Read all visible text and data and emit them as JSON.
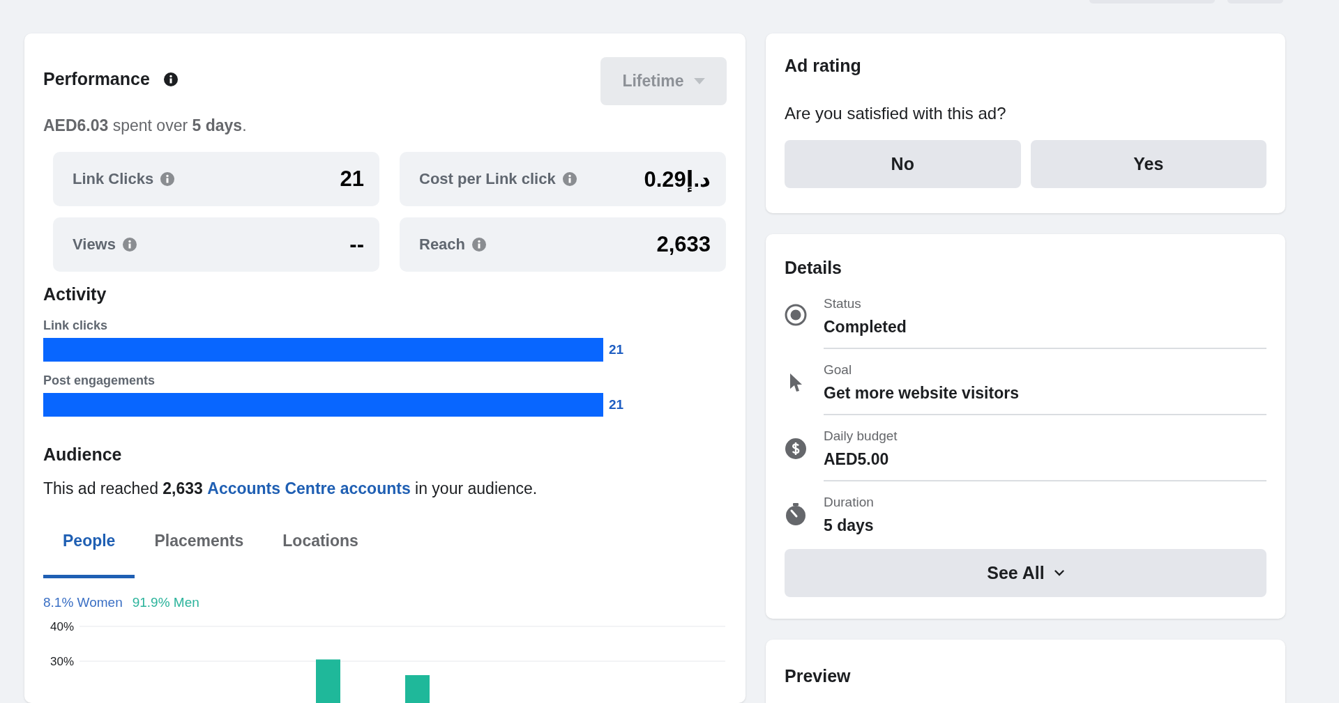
{
  "performance": {
    "title": "Performance",
    "range_button": {
      "label": "Lifetime",
      "disabled": true
    },
    "summary": "**AED6.03** spent over **5 days**.",
    "metrics": [
      {
        "label": "Link Clicks",
        "value": "21"
      },
      {
        "label": "Cost per Link click",
        "value": "0.29د.إ"
      },
      {
        "label": "Views",
        "value": "--"
      },
      {
        "label": "Reach",
        "value": "2,633"
      }
    ]
  },
  "activity": {
    "title": "Activity",
    "bars": [
      {
        "label": "Link clicks",
        "value": "21"
      },
      {
        "label": "Post engagements",
        "value": "21"
      }
    ]
  },
  "audience": {
    "title": "Audience",
    "summary_before": "This ad reached **2,633** ",
    "summary_link": "Accounts Centre accounts",
    "summary_after": " in your audience.",
    "tabs": [
      {
        "label": "People",
        "selected": true
      },
      {
        "label": "Placements",
        "selected": false
      },
      {
        "label": "Locations",
        "selected": false
      }
    ],
    "legend": [
      {
        "label": "8.1% Women",
        "color": "#3a6fc4"
      },
      {
        "label": "91.9% Men",
        "color": "#2bb39b"
      }
    ],
    "chart_data": {
      "type": "bar",
      "ylim": [
        0,
        40
      ],
      "yticks": [
        {
          "value": 40,
          "label": "40%"
        },
        {
          "value": 30,
          "label": "30%"
        }
      ],
      "series": [
        {
          "color": "#1fb89a",
          "values": [
            30.5,
            26
          ]
        }
      ]
    }
  },
  "ad_rating": {
    "title": "Ad rating",
    "question": "Are you satisfied with this ad?",
    "buttons": [
      "No",
      "Yes"
    ]
  },
  "details": {
    "title": "Details",
    "items": [
      {
        "kind": "status",
        "label": "Status",
        "value": "Completed"
      },
      {
        "kind": "goal",
        "label": "Goal",
        "value": "Get more website visitors"
      },
      {
        "kind": "budget",
        "label": "Daily budget",
        "value": "AED5.00"
      },
      {
        "kind": "duration",
        "label": "Duration",
        "value": "5 days"
      }
    ],
    "see_all": "See All"
  },
  "preview": {
    "title": "Preview"
  }
}
